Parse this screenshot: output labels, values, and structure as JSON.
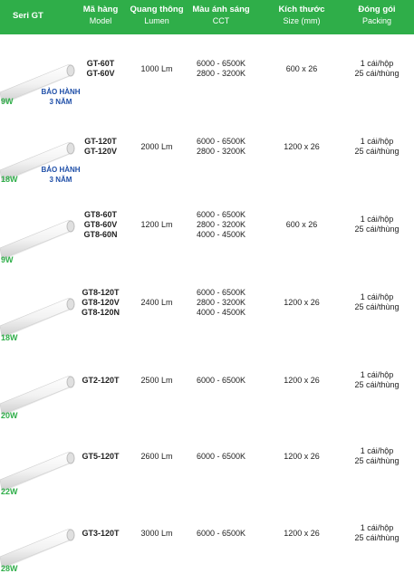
{
  "header": {
    "series": "Seri GT",
    "model_vi": "Mã hàng",
    "model_en": "Model",
    "lumen_vi": "Quang thông",
    "lumen_en": "Lumen",
    "cct_vi": "Màu ánh sáng",
    "cct_en": "CCT",
    "size_vi": "Kích thước",
    "size_en": "Size (mm)",
    "pack_vi": "Đóng gói",
    "pack_en": "Packing"
  },
  "colors": {
    "accent": "#2fae49",
    "warranty": "#1f4fa8"
  },
  "rows": [
    {
      "watt": "9W",
      "warranty": [
        "BẢO HÀNH",
        "3 NĂM"
      ],
      "models": [
        "GT-60T",
        "GT-60V"
      ],
      "lumen": "1000 Lm",
      "cct": [
        "6000 - 6500K",
        "2800 - 3200K"
      ],
      "size": "600 x 26",
      "packing": [
        "1 cái/hộp",
        "25 cái/thùng"
      ]
    },
    {
      "watt": "18W",
      "warranty": [
        "BẢO HÀNH",
        "3 NĂM"
      ],
      "models": [
        "GT-120T",
        "GT-120V"
      ],
      "lumen": "2000 Lm",
      "cct": [
        "6000 - 6500K",
        "2800 - 3200K"
      ],
      "size": "1200 x 26",
      "packing": [
        "1 cái/hộp",
        "25 cái/thùng"
      ]
    },
    {
      "watt": "9W",
      "models": [
        "GT8-60T",
        "GT8-60V",
        "GT8-60N"
      ],
      "lumen": "1200 Lm",
      "cct": [
        "6000 - 6500K",
        "2800 - 3200K",
        "4000 - 4500K"
      ],
      "size": "600 x 26",
      "packing": [
        "1 cái/hộp",
        "25 cái/thùng"
      ]
    },
    {
      "watt": "18W",
      "models": [
        "GT8-120T",
        "GT8-120V",
        "GT8-120N"
      ],
      "lumen": "2400 Lm",
      "cct": [
        "6000 - 6500K",
        "2800 - 3200K",
        "4000 - 4500K"
      ],
      "size": "1200 x 26",
      "packing": [
        "1 cái/hộp",
        "25 cái/thùng"
      ]
    },
    {
      "watt": "20W",
      "models": [
        "GT2-120T"
      ],
      "lumen": "2500 Lm",
      "cct": [
        "6000 - 6500K"
      ],
      "size": "1200 x 26",
      "packing": [
        "1 cái/hộp",
        "25 cái/thùng"
      ]
    },
    {
      "watt": "22W",
      "models": [
        "GT5-120T"
      ],
      "lumen": "2600 Lm",
      "cct": [
        "6000 - 6500K"
      ],
      "size": "1200 x 26",
      "packing": [
        "1 cái/hộp",
        "25 cái/thùng"
      ]
    },
    {
      "watt": "28W",
      "models": [
        "GT3-120T"
      ],
      "lumen": "3000 Lm",
      "cct": [
        "6000 - 6500K"
      ],
      "size": "1200 x 26",
      "packing": [
        "1 cái/hộp",
        "25 cái/thùng"
      ]
    }
  ]
}
